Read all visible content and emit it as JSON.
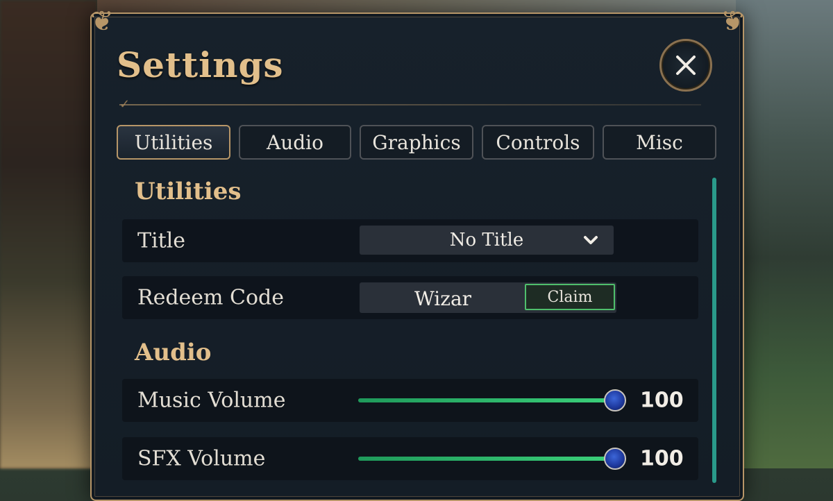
{
  "window": {
    "title": "Settings"
  },
  "tabs": [
    {
      "label": "Utilities",
      "active": true
    },
    {
      "label": "Audio",
      "active": false
    },
    {
      "label": "Graphics",
      "active": false
    },
    {
      "label": "Controls",
      "active": false
    },
    {
      "label": "Misc",
      "active": false
    }
  ],
  "utilities": {
    "heading": "Utilities",
    "title_setting": {
      "label": "Title",
      "selected": "No Title"
    },
    "redeem": {
      "label": "Redeem Code",
      "value": "Wizar",
      "button": "Claim"
    }
  },
  "audio": {
    "heading": "Audio",
    "music": {
      "label": "Music Volume",
      "value": "100",
      "level": 1.0
    },
    "sfx": {
      "label": "SFX Volume",
      "value": "100",
      "level": 1.0
    }
  },
  "colors": {
    "accent": "#e2bf8b",
    "slider": "#3bd07a",
    "claim_border": "#4fbf6c"
  }
}
